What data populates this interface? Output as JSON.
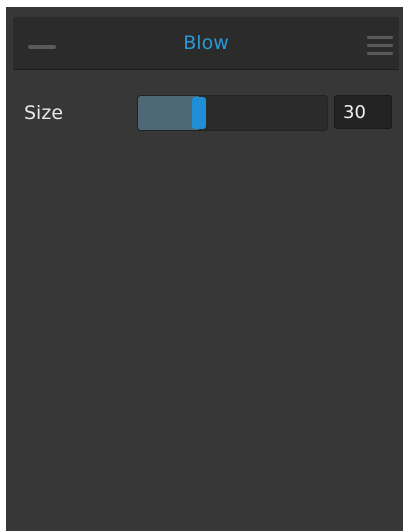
{
  "panel": {
    "title": "Blow",
    "minimize_icon": "minimize-icon",
    "menu_icon": "hamburger-menu-icon",
    "accent_color": "#2b98d8"
  },
  "size_control": {
    "label": "Size",
    "value": "30",
    "fraction": 0.31
  }
}
